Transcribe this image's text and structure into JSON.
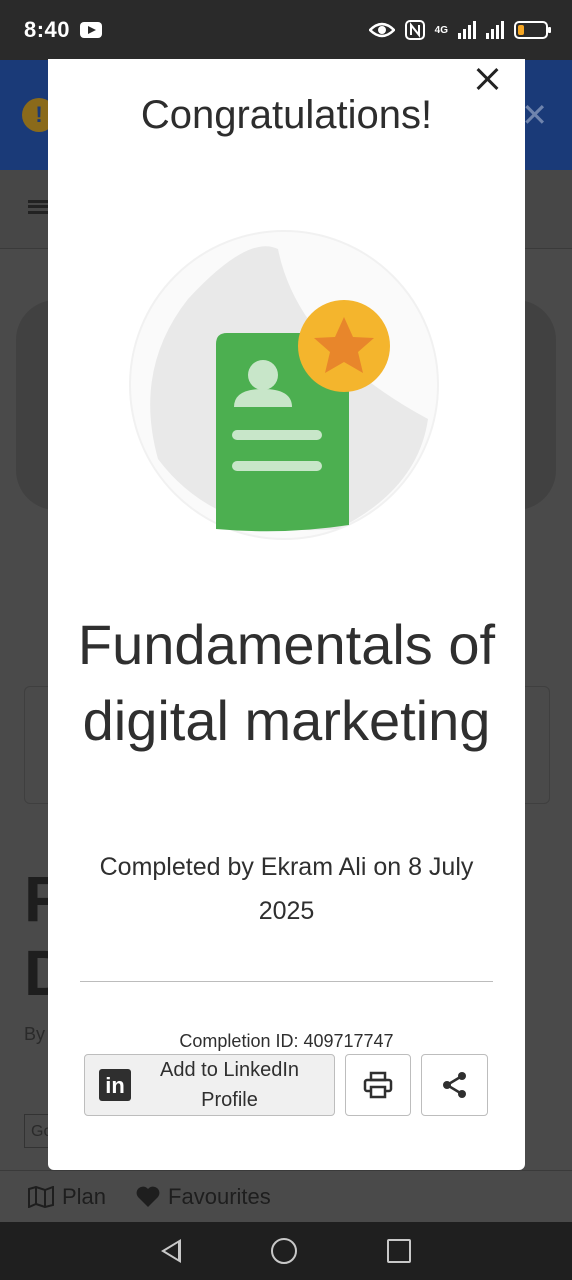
{
  "status_bar": {
    "time": "8:40",
    "network": "4G"
  },
  "background": {
    "nav_plan": "Plan",
    "nav_favourites": "Favourites",
    "by_prefix": "By",
    "go_label": "Go",
    "title_fragment": "F\nD"
  },
  "modal": {
    "heading": "Congratulations!",
    "course_title": "Fundamentals of digital marketing",
    "completed_text": "Completed by Ekram Ali on 8 July 2025",
    "completion_id": "Completion ID: 409717747",
    "linkedin_label": "Add to LinkedIn Profile",
    "linkedin_logo": "in"
  },
  "colors": {
    "badge_green": "#4caf50",
    "star_gold": "#f4b52d",
    "star_orange": "#e8862b"
  },
  "icons": [
    "close-icon",
    "print-icon",
    "share-icon",
    "linkedin-icon",
    "map-icon",
    "heart-icon"
  ]
}
